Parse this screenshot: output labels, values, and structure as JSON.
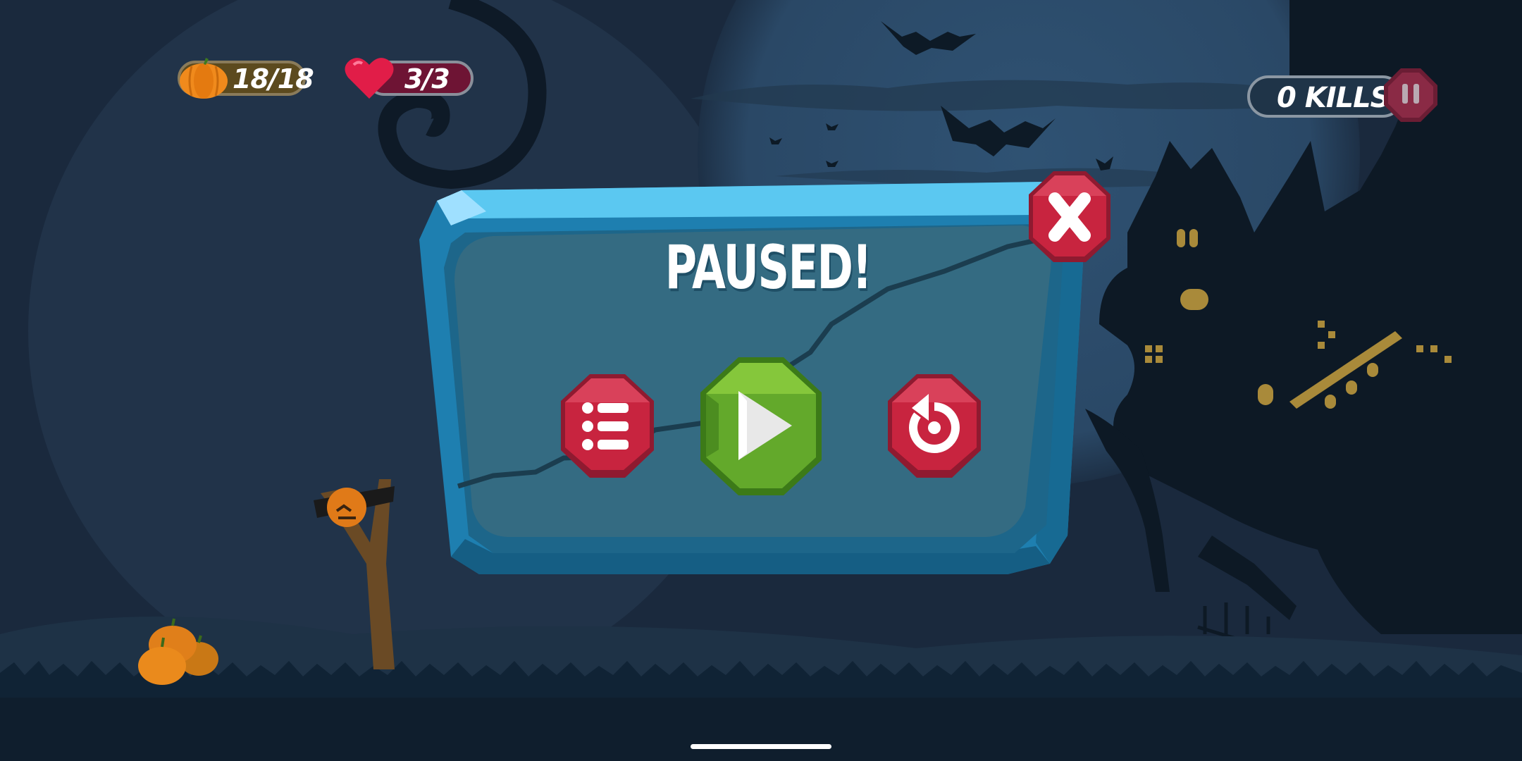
{
  "hud": {
    "pumpkins": {
      "label": "18/18",
      "icon": "pumpkin-icon"
    },
    "lives": {
      "label": "3/3",
      "icon": "heart-icon"
    },
    "kills": {
      "label": "0 KILLS"
    },
    "pause": {
      "icon": "pause-icon"
    }
  },
  "pause_dialog": {
    "title": "PAUSED!",
    "buttons": [
      {
        "name": "menu",
        "icon": "list-icon"
      },
      {
        "name": "resume",
        "icon": "play-icon"
      },
      {
        "name": "restart",
        "icon": "restart-icon"
      },
      {
        "name": "close",
        "icon": "close-icon"
      }
    ]
  },
  "colors": {
    "sky": "#1c2c41",
    "moon": "#2d4e6c",
    "panel_blue": "#3aa6d9",
    "panel_inner": "#34687f",
    "button_red": "#c8243f",
    "button_green": "#63a92b",
    "lives_bar": "#6e1434",
    "pumpkin_bar": "#5c4a1e",
    "pumpkin": "#f08a1c",
    "house_window": "#a98a3a"
  }
}
